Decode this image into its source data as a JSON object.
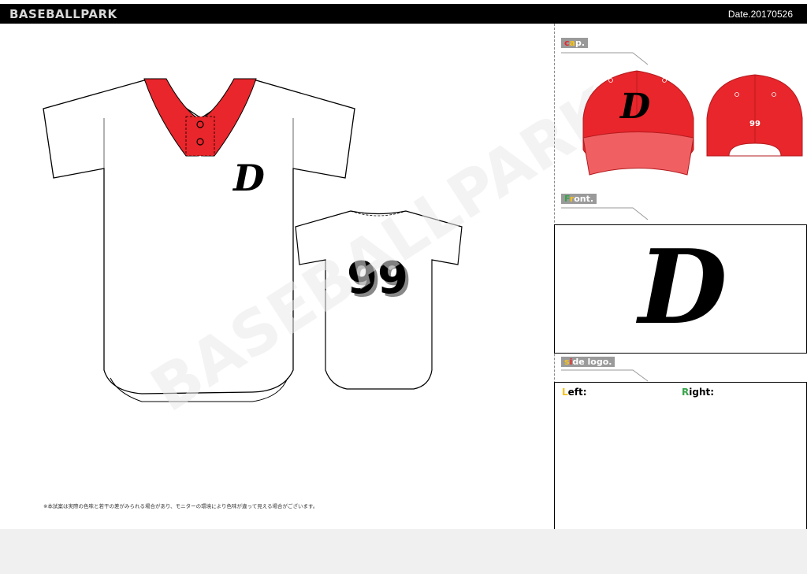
{
  "header": {
    "brand": "BASEBALLPARK",
    "date": "Date.20170526"
  },
  "watermark": "BASEBALLPARK",
  "sections": {
    "cap": {
      "label_first": "c",
      "label_second": "a",
      "label_rest": "p."
    },
    "front": {
      "label_first": "F",
      "label_second": "r",
      "label_rest": "ont."
    },
    "side": {
      "label_first": "s",
      "label_second": "i",
      "label_rest": "de logo."
    }
  },
  "side_logo": {
    "left_first": "L",
    "left_rest": "eft:",
    "right_first": "R",
    "right_rest": "ight:"
  },
  "jersey": {
    "chest_logo": "D",
    "back_number": "99"
  },
  "cap_logo": {
    "front_logo": "D",
    "back_number": "99"
  },
  "front_logo": "D",
  "note": "※本試案は実際の色味と若干の差がみられる場合があり、モニターの環境により色味が違って見える場合がございます。",
  "colors": {
    "accent": "#e8262b",
    "number_shadow": "#888888",
    "bar": "#000000"
  }
}
